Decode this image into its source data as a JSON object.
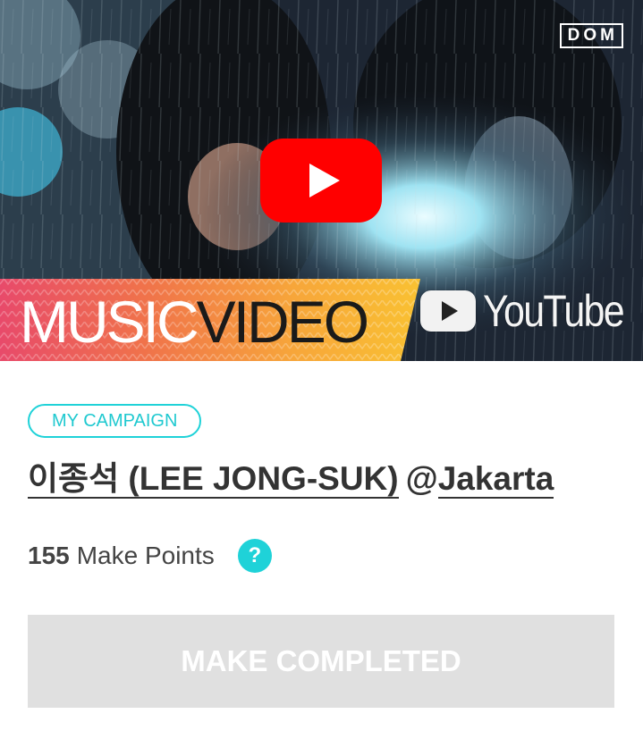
{
  "video": {
    "channel_logo": "DOM",
    "banner_word1": "MUSIC",
    "banner_word2": "VIDEO",
    "platform_name": "YouTube",
    "play_icon": "play-icon",
    "colors": {
      "play_button": "#ff0000",
      "accent": "#1fd2d8"
    }
  },
  "campaign": {
    "badge": "MY CAMPAIGN",
    "artist_link": "이종석 (LEE JONG-SUK)",
    "at_sign": "@",
    "location_link": "Jakarta",
    "points_value": "155",
    "points_label": "Make Points",
    "help_glyph": "?",
    "action_button": "MAKE COMPLETED"
  }
}
